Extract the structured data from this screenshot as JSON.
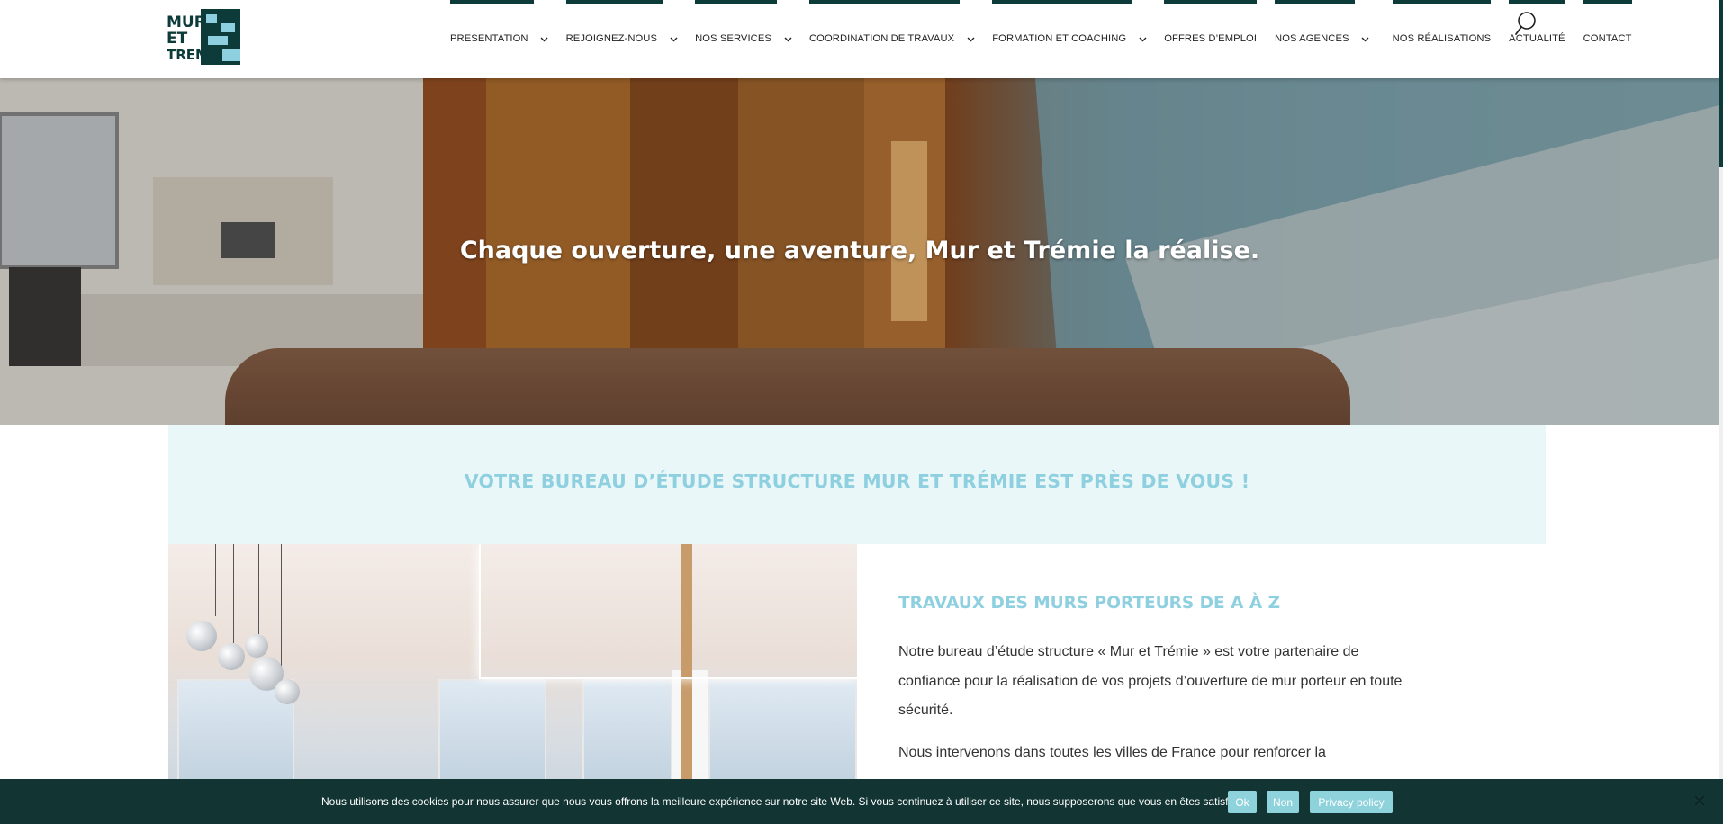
{
  "brand": {
    "logo_alt": "MUR ET TREMIE",
    "logo_line1": "MUR",
    "logo_line2": "ET",
    "logo_line3": "TREMIE",
    "primary_color": "#0d3b3a",
    "accent_color": "#8fd0e0"
  },
  "nav": {
    "items": [
      {
        "label": "PRESENTATION",
        "has_submenu": true
      },
      {
        "label": "REJOIGNEZ-NOUS",
        "has_submenu": true
      },
      {
        "label": "NOS SERVICES",
        "has_submenu": true
      },
      {
        "label": "COORDINATION DE TRAVAUX",
        "has_submenu": true
      },
      {
        "label": "FORMATION ET COACHING",
        "has_submenu": true
      },
      {
        "label": "OFFRES D’EMPLOI",
        "has_submenu": false
      },
      {
        "label": "NOS AGENCES",
        "has_submenu": true
      },
      {
        "label": "NOS RÉALISATIONS",
        "has_submenu": false
      },
      {
        "label": "ACTUALITÉ",
        "has_submenu": false
      },
      {
        "label": "CONTACT",
        "has_submenu": false
      }
    ],
    "search_icon": "search-icon"
  },
  "hero": {
    "title": "Chaque ouverture, une aventure, Mur et Trémie la réalise."
  },
  "band": {
    "title": "VOTRE BUREAU D’ÉTUDE STRUCTURE MUR ET TRÉMIE EST PRÈS DE VOUS !"
  },
  "section": {
    "title": "TRAVAUX DES MURS PORTEURS DE A À Z",
    "paragraph1": "Notre bureau d’étude structure « Mur et Trémie » est votre partenaire de confiance pour la réalisation de vos projets d’ouverture de mur porteur en toute sécurité.",
    "paragraph2": "Nous intervenons dans toutes les villes de France pour renforcer la"
  },
  "cookie": {
    "text": "Nous utilisons des cookies pour nous assurer que nous vous offrons la meilleure expérience sur notre site Web. Si vous continuez à utiliser ce site, nous supposerons que vous en êtes satisfait.",
    "ok_label": "Ok",
    "no_label": "Non",
    "privacy_label": "Privacy policy"
  }
}
